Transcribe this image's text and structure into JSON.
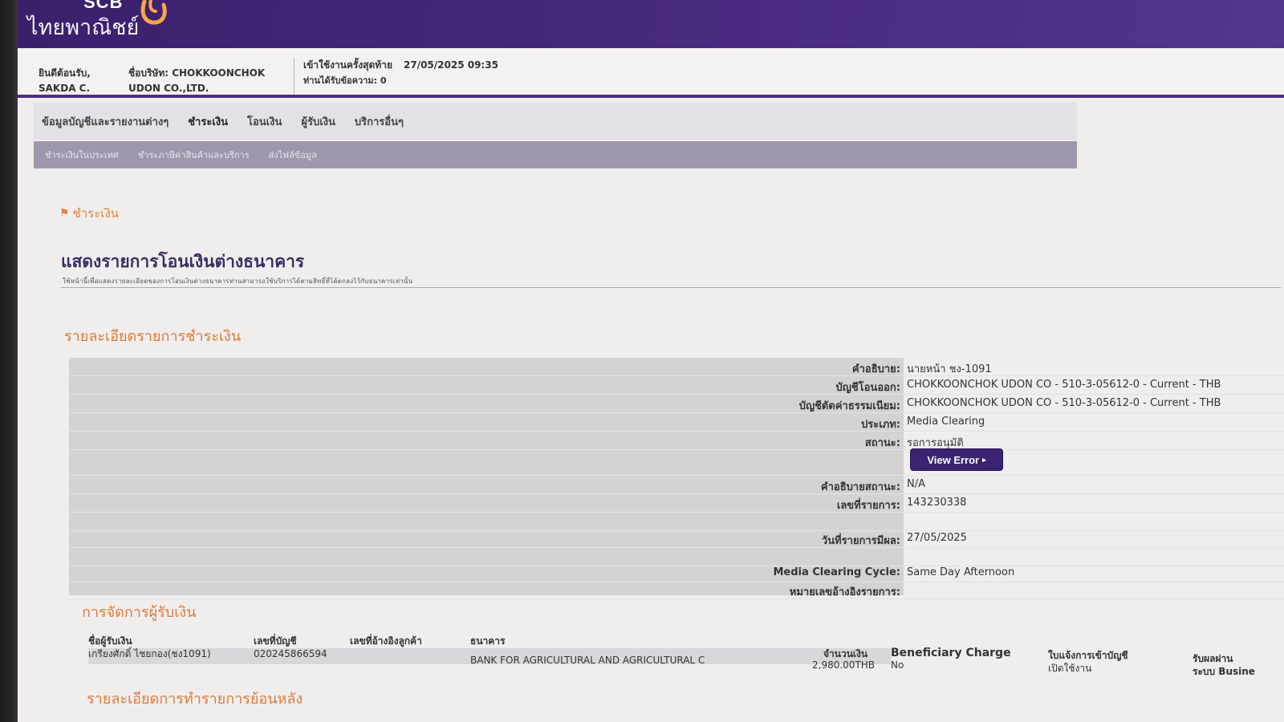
{
  "brand": {
    "name_en": "SCB",
    "name_th": "ไทยพาณิชย์",
    "accent": "#4a2b7f",
    "logo_icon": "scb-emblem-icon"
  },
  "info": {
    "welcome_label": "ยินดีต้อนรับ,",
    "welcome_user": "SAKDA C.",
    "company_label": "ชื่อบริษัท: CHOKKOONCHOK",
    "company_line2": "UDON CO.,LTD.",
    "last_login_label": "เข้าใช้งานครั้งสุดท้าย",
    "last_login_value": "27/05/2025 09:35",
    "messages": "ท่านได้รับข้อความ: 0"
  },
  "nav": {
    "items": [
      "ข้อมูลบัญชีและรายงานต่างๆ",
      "ชำระเงิน",
      "โอนเงิน",
      "ผู้รับเงิน",
      "บริการอื่นๆ"
    ],
    "active_index": 1
  },
  "subnav": {
    "items": [
      "ชำระเงินในประเทศ",
      "ชำระภาษีค่าสินค้าและบริการ",
      "ส่งไฟล์ข้อมูล"
    ]
  },
  "breadcrumb": "ชำระเงิน",
  "page": {
    "title": "แสดงรายการโอนเงินต่างธนาคาร",
    "subtitle": "ใช้หน้านี้เพื่อแสดงรายละเอียดของการโอนเงินต่างธนาคารท่านสามารถใช้บริการได้ตามสิทธิ์ที่ได้ตกลงไว้กับธนาคารเท่านั้น"
  },
  "sections": {
    "payment_details": "รายละเอียดรายการชำระเงิน",
    "payee_management": "การจัดการผู้รับเงิน",
    "history": "รายละเอียดการทำรายการย้อนหลัง"
  },
  "details": {
    "rows": [
      {
        "label": "คำอธิบาย:",
        "value": "นายหน้า ชง-1091"
      },
      {
        "label": "บัญชีโอนออก:",
        "value": "CHOKKOONCHOK UDON CO - 510-3-05612-0 - Current - THB"
      },
      {
        "label": "บัญชีตัดค่าธรรมเนียม:",
        "value": "CHOKKOONCHOK UDON CO - 510-3-05612-0 - Current - THB"
      },
      {
        "label": "ประเภท:",
        "value": "Media Clearing"
      },
      {
        "label": "สถานะ:",
        "value": "รอการอนุมัติ"
      },
      {
        "label": "",
        "value": ""
      },
      {
        "label": "คำอธิบายสถานะ:",
        "value": "N/A"
      },
      {
        "label": "เลขที่รายการ:",
        "value": "143230338"
      },
      {
        "label": "",
        "value": ""
      },
      {
        "label": "วันที่รายการมีผล:",
        "value": "27/05/2025"
      },
      {
        "label": "",
        "value": ""
      },
      {
        "label": "Media Clearing Cycle:",
        "value": "Same Day Afternoon"
      },
      {
        "label": "หมายเลขอ้างอิงรายการ:",
        "value": ""
      }
    ],
    "view_error_label": "View Error"
  },
  "payees": {
    "headers": {
      "name": "ชื่อผู้รับเงิน",
      "account": "เลขที่บัญชี",
      "customer_ref": "เลขที่อ้างอิงลูกค้า",
      "bank": "ธนาคาร",
      "amount": "จำนวนเงิน",
      "beneficiary_charge": "Beneficiary Charge",
      "notice_line1": "ใบแจ้งการเข้าบัญชี",
      "notice_line2": "เปิดใช้งาน",
      "receive_line1": "รับผลผ่าน",
      "receive_line2": "ระบบ Busine"
    },
    "rows": [
      {
        "name": "เกรียงศักดิ์ ไชยกอง(ชง1091)",
        "account": "020245866594",
        "customer_ref": "",
        "bank": "BANK FOR AGRICULTURAL AND AGRICULTURAL C",
        "amount": "2,980.00THB",
        "beneficiary_charge": "No"
      }
    ]
  }
}
